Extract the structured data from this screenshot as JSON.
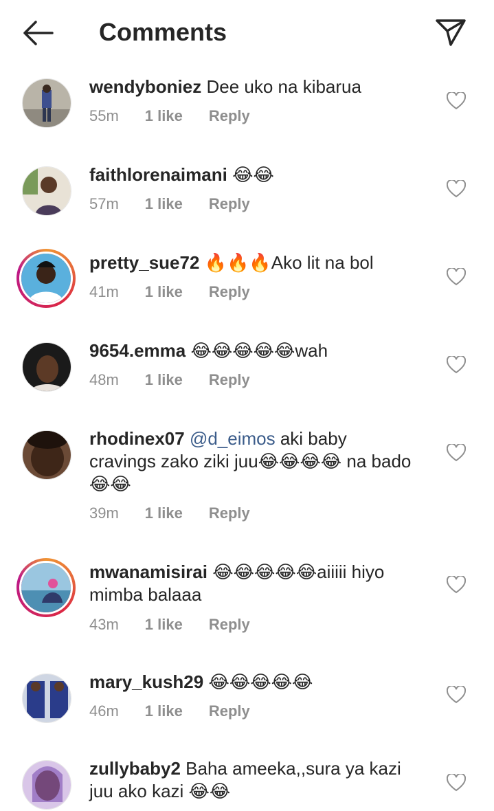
{
  "header": {
    "title": "Comments"
  },
  "comments": [
    {
      "username": "wendyboniez",
      "text": "Dee uko na kibarua",
      "time": "55m",
      "likes": "1 like",
      "reply": "Reply"
    },
    {
      "username": "faithlorenaimani",
      "text": "😂😂",
      "time": "57m",
      "likes": "1 like",
      "reply": "Reply"
    },
    {
      "username": "pretty_sue72",
      "text": "🔥🔥🔥Ako lit na bol",
      "time": "41m",
      "likes": "1 like",
      "reply": "Reply"
    },
    {
      "username": "9654.emma",
      "text": "😂😂😂😂😂wah",
      "time": "48m",
      "likes": "1 like",
      "reply": "Reply"
    },
    {
      "username": "rhodinex07",
      "mention": "@d_eimos",
      "text": " aki baby cravings zako ziki juu😂😂😂😂 na bado😂😂",
      "time": "39m",
      "likes": "1 like",
      "reply": "Reply"
    },
    {
      "username": "mwanamisirai",
      "text": "😂😂😂😂😂aiiiii hiyo mimba balaaa",
      "time": "43m",
      "likes": "1 like",
      "reply": "Reply"
    },
    {
      "username": "mary_kush29",
      "text": "😂😂😂😂😂",
      "time": "46m",
      "likes": "1 like",
      "reply": "Reply"
    },
    {
      "username": "zullybaby2",
      "text": "Baha ameeka,,sura ya kazi juu ako kazi 😂😂"
    }
  ],
  "colors": {
    "story_ring": "#dc2743",
    "meta": "#8e8e8e",
    "mention": "#3b5c8a"
  }
}
